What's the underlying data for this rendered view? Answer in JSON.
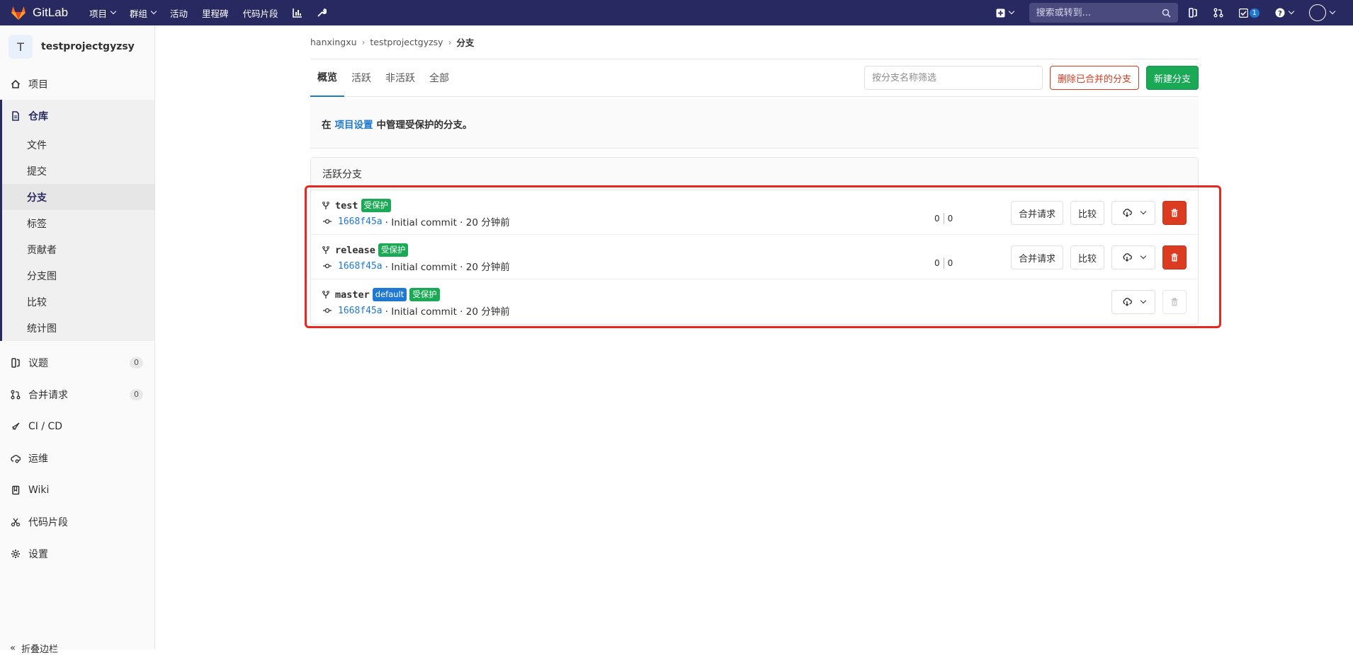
{
  "navbar": {
    "brand": "GitLab",
    "items": [
      {
        "label": "项目",
        "dropdown": true
      },
      {
        "label": "群组",
        "dropdown": true
      },
      {
        "label": "活动",
        "dropdown": false
      },
      {
        "label": "里程碑",
        "dropdown": false
      },
      {
        "label": "代码片段",
        "dropdown": false
      }
    ],
    "search_placeholder": "搜索或转到...",
    "todo_count": "1"
  },
  "sidebar": {
    "project_initial": "T",
    "project_name": "testprojectgyzsy",
    "items_top": [
      {
        "label": "项目",
        "icon": "home-icon"
      }
    ],
    "repository": {
      "label": "仓库",
      "sub": [
        "文件",
        "提交",
        "分支",
        "标签",
        "贡献者",
        "分支图",
        "比较",
        "统计图"
      ],
      "active_sub": "分支"
    },
    "items_bottom": [
      {
        "label": "议题",
        "icon": "issues-icon",
        "count": "0"
      },
      {
        "label": "合并请求",
        "icon": "merge-request-icon",
        "count": "0"
      },
      {
        "label": "CI / CD",
        "icon": "rocket-icon"
      },
      {
        "label": "运维",
        "icon": "cloud-gear-icon"
      },
      {
        "label": "Wiki",
        "icon": "book-icon"
      },
      {
        "label": "代码片段",
        "icon": "snippet-icon"
      },
      {
        "label": "设置",
        "icon": "gear-icon"
      }
    ],
    "collapse_label": "折叠边栏"
  },
  "breadcrumb": {
    "owner": "hanxingxu",
    "project": "testprojectgyzsy",
    "current": "分支"
  },
  "tabs": [
    "概览",
    "活跃",
    "非活跃",
    "全部"
  ],
  "filter_placeholder": "按分支名称筛选",
  "buttons": {
    "delete_merged": "删除已合并的分支",
    "new_branch": "新建分支",
    "merge_request": "合并请求",
    "compare": "比较"
  },
  "info": {
    "prefix": "在",
    "link": "项目设置",
    "suffix": "中管理受保护的分支。"
  },
  "panel_title": "活跃分支",
  "branches": [
    {
      "name": "test",
      "labels": [
        "受保护"
      ],
      "default": false,
      "sha": "1668f45a",
      "commit": "· Initial commit · 20 分钟前",
      "behind": "0",
      "ahead": "0",
      "deletable": true
    },
    {
      "name": "release",
      "labels": [
        "受保护"
      ],
      "default": false,
      "sha": "1668f45a",
      "commit": "· Initial commit · 20 分钟前",
      "behind": "0",
      "ahead": "0",
      "deletable": true
    },
    {
      "name": "master",
      "labels": [
        "default",
        "受保护"
      ],
      "default": true,
      "sha": "1668f45a",
      "commit": "· Initial commit · 20 分钟前",
      "deletable": false
    }
  ],
  "colors": {
    "navbar": "#292961",
    "link": "#1f78d1",
    "success": "#1aaa55",
    "danger": "#db3b21",
    "highlight": "#e8281e"
  }
}
